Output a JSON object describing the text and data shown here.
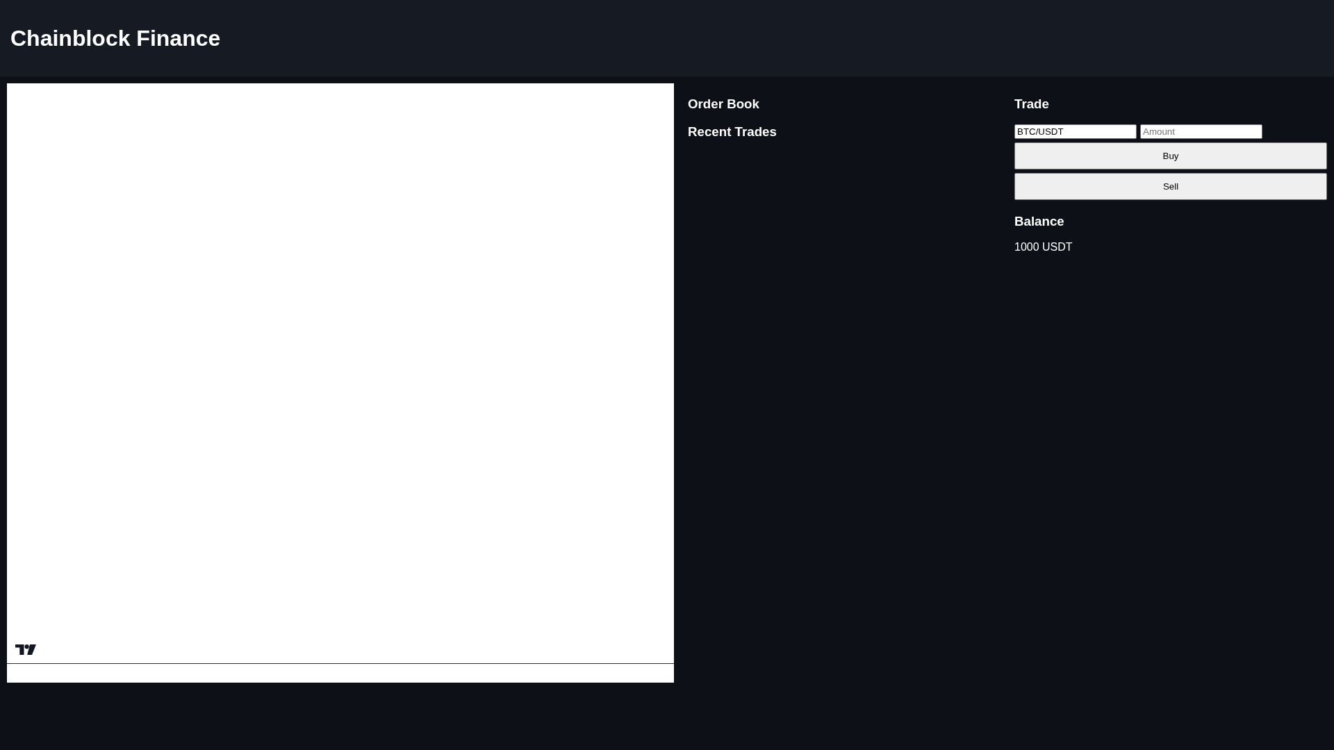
{
  "header": {
    "title": "Chainblock Finance"
  },
  "order_book": {
    "title": "Order Book"
  },
  "recent_trades": {
    "title": "Recent Trades"
  },
  "trade": {
    "title": "Trade",
    "fields": [
      {
        "value": "BTC/USDT"
      },
      {
        "placeholder": "Amount"
      }
    ],
    "buttons": [
      {
        "label": "Buy"
      },
      {
        "label": "Sell"
      }
    ]
  },
  "balance": {
    "title": "Balance",
    "amount": "1000 USDT"
  }
}
